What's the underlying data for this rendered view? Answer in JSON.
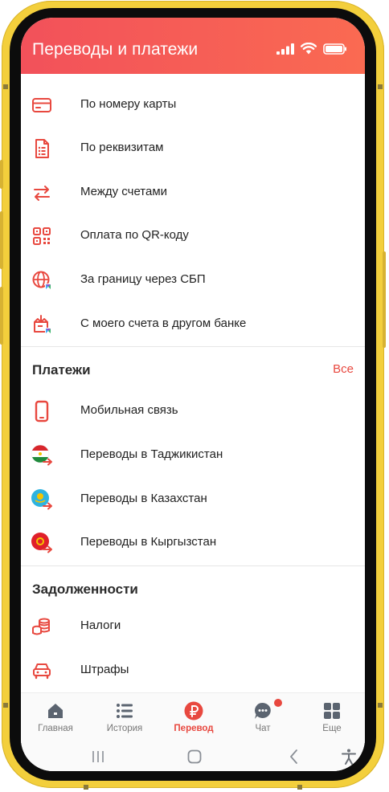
{
  "header": {
    "title": "Переводы и платежи"
  },
  "transfers": [
    {
      "label": "По номеру карты",
      "icon": "card-icon"
    },
    {
      "label": "По реквизитам",
      "icon": "document-icon"
    },
    {
      "label": "Между счетами",
      "icon": "swap-arrows-icon"
    },
    {
      "label": "Оплата по QR-коду",
      "icon": "qr-code-icon"
    },
    {
      "label": "За границу через СБП",
      "icon": "globe-sbp-icon"
    },
    {
      "label": "С моего счета в другом банке",
      "icon": "bank-transfer-icon"
    }
  ],
  "payments": {
    "title": "Платежи",
    "see_all": "Все",
    "items": [
      {
        "label": "Мобильная связь",
        "icon": "mobile-phone-icon"
      },
      {
        "label": "Переводы в Таджикистан",
        "icon": "tajikistan-flag-icon"
      },
      {
        "label": "Переводы в Казахстан",
        "icon": "kazakhstan-flag-icon"
      },
      {
        "label": "Переводы в Кыргызстан",
        "icon": "kyrgyzstan-flag-icon"
      }
    ]
  },
  "debts": {
    "title": "Задолженности",
    "items": [
      {
        "label": "Налоги",
        "icon": "coins-icon"
      },
      {
        "label": "Штрафы",
        "icon": "car-icon"
      }
    ]
  },
  "tabbar": [
    {
      "label": "Главная",
      "icon": "home-icon",
      "active": false
    },
    {
      "label": "История",
      "icon": "list-icon",
      "active": false
    },
    {
      "label": "Перевод",
      "icon": "ruble-icon",
      "active": true
    },
    {
      "label": "Чат",
      "icon": "chat-icon",
      "active": false,
      "badge": true
    },
    {
      "label": "Еще",
      "icon": "grid-icon",
      "active": false
    }
  ],
  "colors": {
    "accent": "#e8483f",
    "header_start": "#f2515a",
    "header_end": "#fa6a52",
    "frame": "#f3cf3c"
  }
}
